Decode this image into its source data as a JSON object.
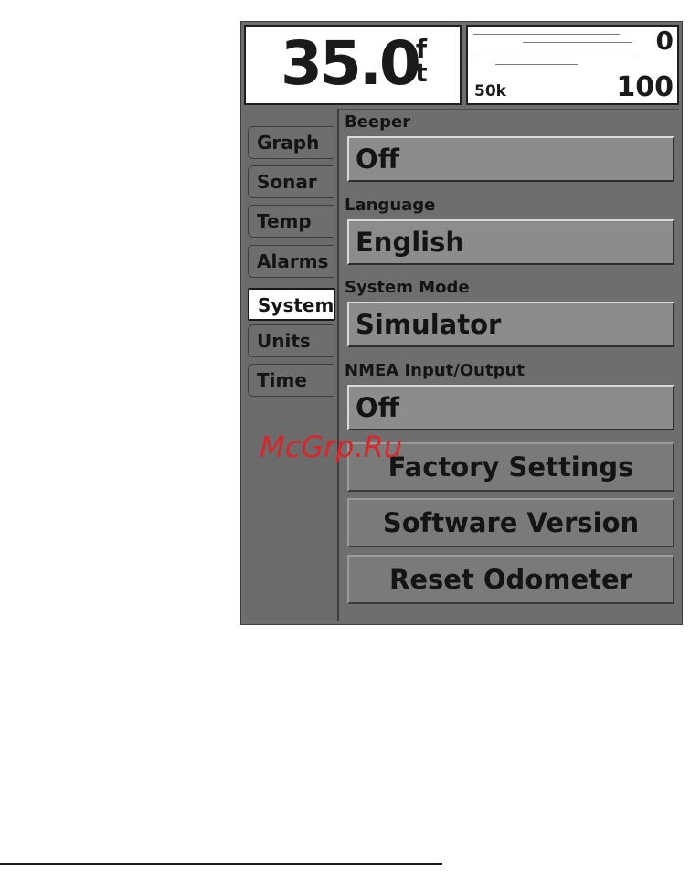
{
  "depth": {
    "value": "35.0",
    "unit_top": "f",
    "unit_bottom": "t"
  },
  "sonar": {
    "top_value": "0",
    "bottom_value": "100",
    "frequency": "50k"
  },
  "tabs": [
    {
      "label": "Graph"
    },
    {
      "label": "Sonar"
    },
    {
      "label": "Temp"
    },
    {
      "label": "Alarms"
    },
    {
      "label": "System",
      "active": true
    },
    {
      "label": "Units"
    },
    {
      "label": "Time"
    }
  ],
  "fields": [
    {
      "label": "Beeper",
      "value": "Off"
    },
    {
      "label": "Language",
      "value": "English"
    },
    {
      "label": "System Mode",
      "value": "Simulator"
    },
    {
      "label": "NMEA Input/Output",
      "value": "Off"
    }
  ],
  "buttons": [
    {
      "label": "Factory Settings"
    },
    {
      "label": "Software Version"
    },
    {
      "label": "Reset Odometer"
    }
  ],
  "watermark": "McGrp.Ru",
  "colors": {
    "screen_bg": "#6e6e6e",
    "field_bg": "#8c8c8c",
    "watermark": "#d9262b"
  }
}
